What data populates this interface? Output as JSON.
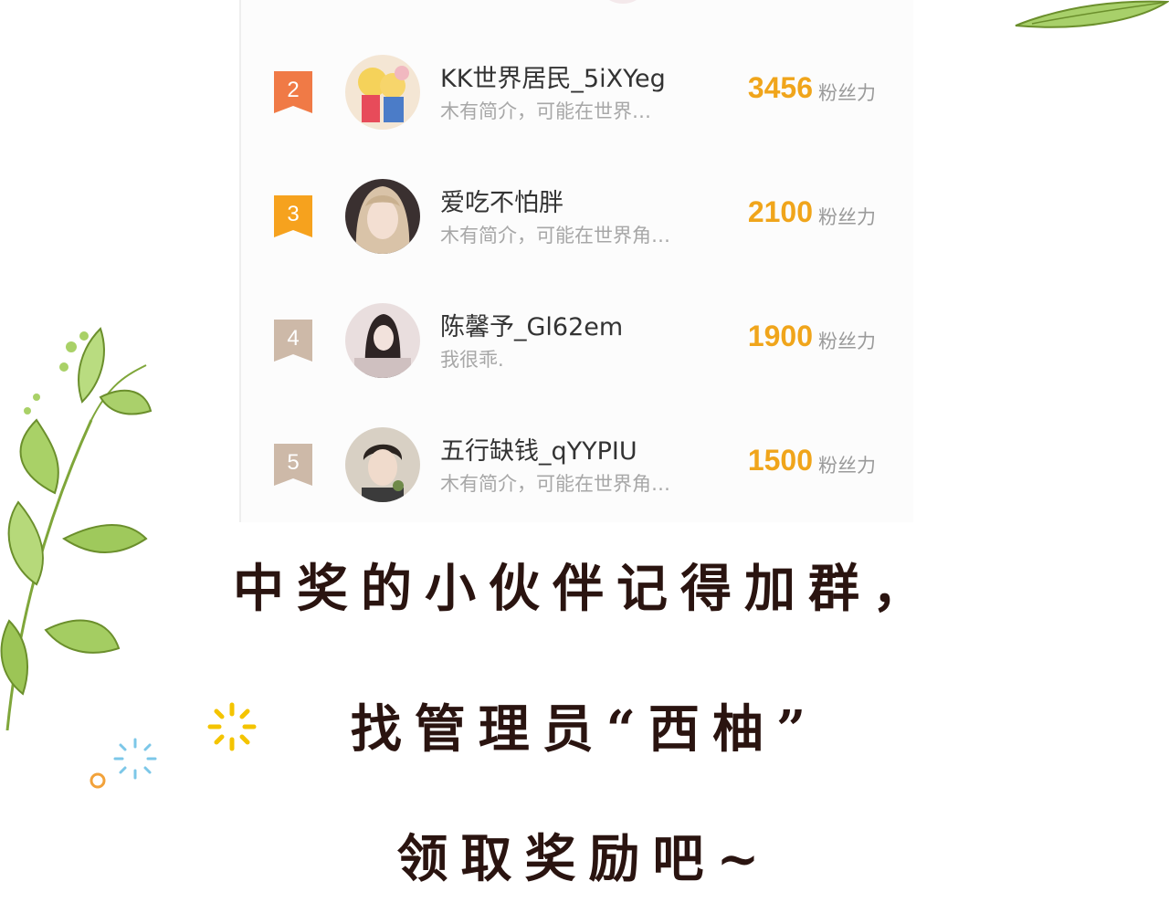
{
  "ranking": {
    "score_unit": "粉丝力",
    "rows": [
      {
        "rank": "2",
        "name": "KK世界居民_5iXYeg",
        "bio": "木有简介，可能在世界…",
        "score": "3456",
        "rank_color": "#f07a46"
      },
      {
        "rank": "3",
        "name": "爱吃不怕胖",
        "bio": "木有简介，可能在世界角…",
        "score": "2100",
        "rank_color": "#f6a21e"
      },
      {
        "rank": "4",
        "name": "陈馨予_Gl62em",
        "bio": "我很乖.",
        "score": "1900",
        "rank_color": "#cdb9a8"
      },
      {
        "rank": "5",
        "name": "五行缺钱_qYYPIU",
        "bio": "木有简介，可能在世界角…",
        "score": "1500",
        "rank_color": "#cdb9a8"
      }
    ]
  },
  "caption": {
    "line1": "中奖的小伙伴记得加群，",
    "line2": "找管理员“西柚”",
    "line3": "领取奖励吧~"
  },
  "colors": {
    "accent": "#f0a51b",
    "caption_text": "#2a1410"
  },
  "icons": {
    "rank_badge": "ribbon-badge-icon",
    "decoration_leaves": "leaf-branch-icon",
    "decoration_sparkles": "sparkle-icon"
  }
}
